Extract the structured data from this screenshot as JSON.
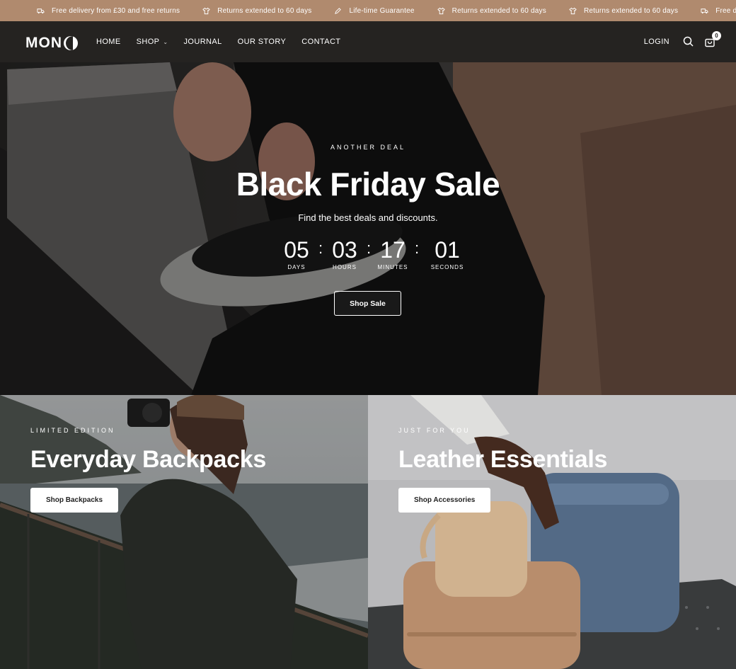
{
  "announcement": {
    "items": [
      {
        "icon": "truck-icon",
        "text": "Free delivery from £30 and free returns"
      },
      {
        "icon": "shirt-icon",
        "text": "Returns extended to 60 days"
      },
      {
        "icon": "pen-icon",
        "text": "Life-time Guarantee"
      },
      {
        "icon": "shirt-icon",
        "text": "Returns extended to 60 days"
      },
      {
        "icon": "shirt-icon",
        "text": "Returns extended to 60 days"
      },
      {
        "icon": "truck-icon",
        "text": "Free delivery"
      }
    ]
  },
  "header": {
    "logo": "MON",
    "nav": [
      "HOME",
      "SHOP",
      "JOURNAL",
      "OUR STORY",
      "CONTACT"
    ],
    "login": "LOGIN",
    "cart_count": "0"
  },
  "hero": {
    "eyebrow": "ANOTHER DEAL",
    "title": "Black Friday Sale",
    "subtitle": "Find the best deals and discounts.",
    "countdown": {
      "days": "05",
      "days_label": "DAYS",
      "hours": "03",
      "hours_label": "HOURS",
      "minutes": "17",
      "minutes_label": "MINUTES",
      "seconds": "01",
      "seconds_label": "SECONDS",
      "separator": ":"
    },
    "button": "Shop Sale"
  },
  "tiles": [
    {
      "eyebrow": "LIMITED EDITION",
      "title": "Everyday Backpacks",
      "button": "Shop Backpacks"
    },
    {
      "eyebrow": "JUST FOR YOU",
      "title": "Leather Essentials",
      "button": "Shop Accessories"
    }
  ],
  "colors": {
    "announcement_bg": "#b08a6e",
    "header_bg": "#252321",
    "text_light": "#ffffff"
  }
}
